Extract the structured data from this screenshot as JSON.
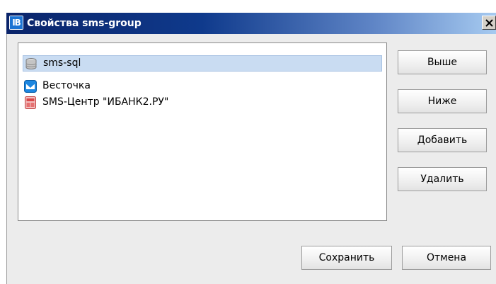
{
  "window": {
    "title": "Свойства sms-group",
    "app_icon_text": "IB"
  },
  "list": {
    "items": [
      {
        "label": "sms-sql",
        "icon": "database-icon",
        "selected": true
      },
      {
        "label": "Весточка",
        "icon": "vestochka-icon",
        "selected": false
      },
      {
        "label": "SMS-Центр \"ИБАНК2.РУ\"",
        "icon": "sms-center-icon",
        "selected": false
      }
    ]
  },
  "side_buttons": {
    "up": "Выше",
    "down": "Ниже",
    "add": "Добавить",
    "delete": "Удалить"
  },
  "footer": {
    "save": "Сохранить",
    "cancel": "Отмена"
  },
  "colors": {
    "titlebar_start": "#0a246a",
    "titlebar_end": "#a6caf0",
    "selection": "#c9dcf2",
    "window_bg": "#ececec"
  }
}
